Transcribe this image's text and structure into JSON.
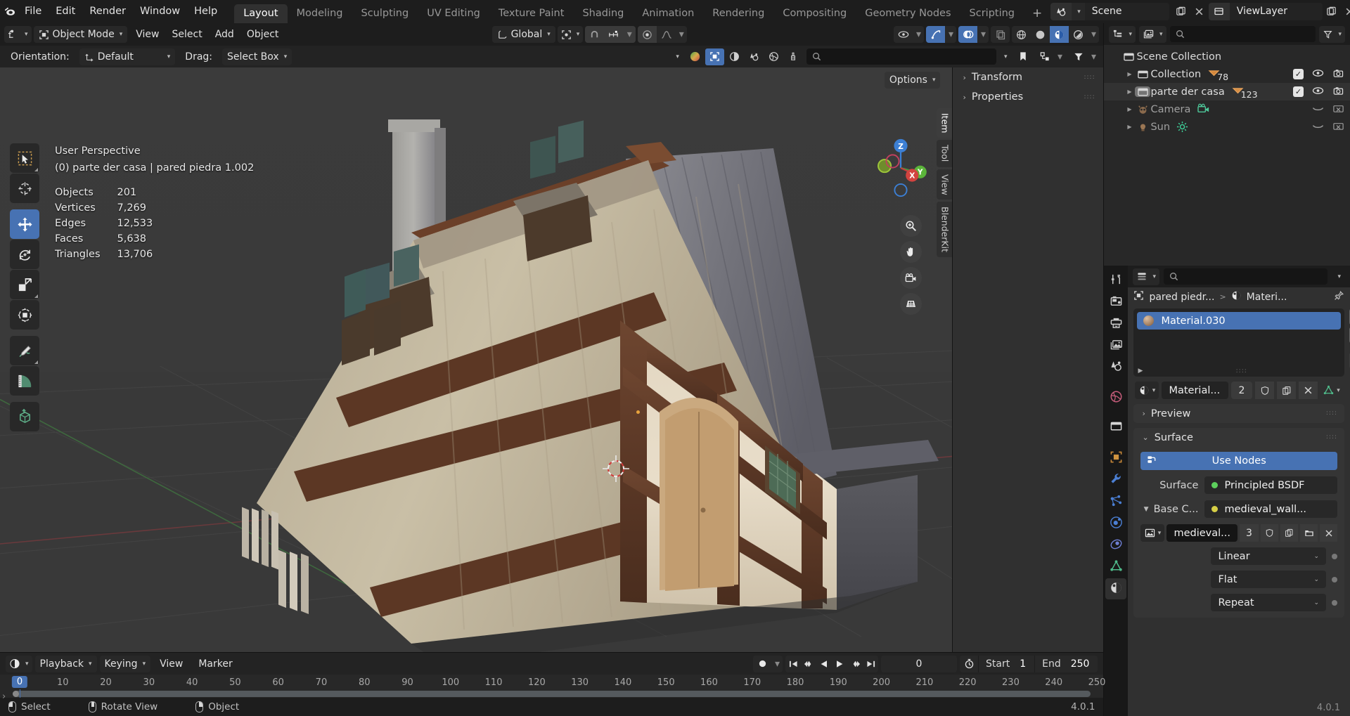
{
  "app": {
    "version": "4.0.1"
  },
  "topbar": {
    "logo_icon": "blender-logo-icon",
    "menus": [
      "File",
      "Edit",
      "Render",
      "Window",
      "Help"
    ],
    "workspace_tabs": [
      {
        "label": "Layout",
        "active": true
      },
      {
        "label": "Modeling",
        "active": false
      },
      {
        "label": "Sculpting",
        "active": false
      },
      {
        "label": "UV Editing",
        "active": false
      },
      {
        "label": "Texture Paint",
        "active": false
      },
      {
        "label": "Shading",
        "active": false
      },
      {
        "label": "Animation",
        "active": false
      },
      {
        "label": "Rendering",
        "active": false
      },
      {
        "label": "Compositing",
        "active": false
      },
      {
        "label": "Geometry Nodes",
        "active": false
      },
      {
        "label": "Scripting",
        "active": false
      }
    ],
    "add_workspace_label": "+",
    "scene": {
      "icon": "scene-icon",
      "name": "Scene",
      "new_icon": "new-scene-icon",
      "unlink_icon": "unlink-icon"
    },
    "viewlayer": {
      "icon": "viewlayer-icon",
      "name": "ViewLayer",
      "new_icon": "new-viewlayer-icon",
      "remove_icon": "remove-viewlayer-icon"
    }
  },
  "viewport_header": {
    "editor_type_icon": "editor-type-icon",
    "mode": "Object Mode",
    "menus": [
      "View",
      "Select",
      "Add",
      "Object"
    ],
    "transform_orientation": "Global",
    "pivot_icon": "pivot-point-icon",
    "snap_magnet_icon": "snap-magnet-icon",
    "snap_increment_icon": "snap-increment-icon",
    "proportional_icon": "proportional-editing-icon",
    "falloff_icon": "proportional-falloff-icon",
    "gizmo_icon": "gizmo-icon",
    "overlay_icon": "overlays-icon",
    "xray_icon": "xray-icon",
    "shading_wireframe_icon": "shading-wireframe-icon",
    "shading_solid_icon": "shading-solid-icon",
    "shading_material_icon": "shading-material-preview-icon",
    "shading_rendered_icon": "shading-rendered-icon",
    "visibility_icon": "visibility-icon"
  },
  "tool_header": {
    "orientation_label": "Orientation:",
    "orientation_value": "Default",
    "drag_label": "Drag:",
    "drag_value": "Select Box",
    "options_label": "Options",
    "mode_icons": [
      "render-icon",
      "output-icon",
      "viewlayer-props-icon",
      "scene-props-icon",
      "world-props-icon",
      "tool-props-icon"
    ],
    "search_placeholder": ""
  },
  "toolbar": {
    "tools": [
      {
        "name": "tweak-tool",
        "icon": "cursor-arrow-icon",
        "active": false
      },
      {
        "name": "cursor-tool",
        "icon": "3d-cursor-icon",
        "active": false
      },
      {
        "name": "move-tool",
        "icon": "move-arrows-icon",
        "active": true
      },
      {
        "name": "rotate-tool",
        "icon": "rotate-icon",
        "active": false
      },
      {
        "name": "scale-tool",
        "icon": "scale-icon",
        "active": false
      },
      {
        "name": "transform-tool",
        "icon": "transform-icon",
        "active": false
      },
      {
        "name": "annotate-tool",
        "icon": "pencil-icon",
        "active": false
      },
      {
        "name": "measure-tool",
        "icon": "ruler-icon",
        "active": false
      },
      {
        "name": "add-cube-tool",
        "icon": "add-cube-icon",
        "active": false
      }
    ]
  },
  "viewport": {
    "perspective": "User Perspective",
    "context": "(0) parte der casa | pared piedra 1.002",
    "stats": [
      {
        "label": "Objects",
        "value": "201"
      },
      {
        "label": "Vertices",
        "value": "7,269"
      },
      {
        "label": "Edges",
        "value": "12,533"
      },
      {
        "label": "Faces",
        "value": "5,638"
      },
      {
        "label": "Triangles",
        "value": "13,706"
      }
    ],
    "gizmo_axes": [
      "Z",
      "X",
      "Y"
    ],
    "nav_buttons": [
      "zoom-icon",
      "pan-hand-icon",
      "camera-view-icon",
      "toggle-perspective-icon"
    ]
  },
  "npanel": {
    "sections": [
      {
        "label": "Transform",
        "expanded": false
      },
      {
        "label": "Properties",
        "expanded": false
      }
    ],
    "tabs": [
      {
        "label": "Item",
        "active": true
      },
      {
        "label": "Tool",
        "active": false
      },
      {
        "label": "View",
        "active": false
      },
      {
        "label": "BlenderKit",
        "active": false
      }
    ]
  },
  "outliner": {
    "display_mode_icon": "outliner-display-mode-icon",
    "filter_id_icon": "filter-id-icon",
    "search_placeholder": "",
    "filter_icon": "funnel-filter-icon",
    "rows": [
      {
        "name": "Scene Collection",
        "icon": "collection-icon",
        "indent": 0,
        "disclosure": "none",
        "badge": "",
        "dim": false,
        "selected": false,
        "checkbox": false,
        "eye": false,
        "camera": false
      },
      {
        "name": "Collection",
        "icon": "collection-icon",
        "indent": 1,
        "disclosure": "closed",
        "badge": "78",
        "badge_icon": "mesh-data-icon",
        "dim": false,
        "selected": false,
        "checkbox": true,
        "eye": true,
        "camera": true
      },
      {
        "name": "parte der casa",
        "icon": "collection-icon",
        "indent": 1,
        "disclosure": "closed",
        "badge": "123",
        "badge_icon": "mesh-data-icon",
        "dim": false,
        "selected": true,
        "checkbox": true,
        "eye": true,
        "camera": true
      },
      {
        "name": "Camera",
        "icon": "camera-object-icon",
        "indent": 1,
        "disclosure": "closed",
        "badge": "",
        "badge_icon": "camera-data-icon",
        "dim": true,
        "selected": false,
        "checkbox": false,
        "eye": true,
        "camera": true
      },
      {
        "name": "Sun",
        "icon": "light-object-icon",
        "indent": 1,
        "disclosure": "closed",
        "badge": "",
        "badge_icon": "sun-data-icon",
        "dim": true,
        "selected": false,
        "checkbox": false,
        "eye": true,
        "camera": true
      }
    ]
  },
  "properties": {
    "editor_icon": "properties-editor-icon",
    "search_placeholder": "",
    "breadcrumb": {
      "object": "pared piedr...",
      "separator": ">",
      "material": "Materi...",
      "object_icon": "object-data-icon",
      "material_icon": "material-icon",
      "pin_icon": "pin-icon"
    },
    "tabs": [
      {
        "name": "tool-tab",
        "icon": "tool-icon",
        "active": false
      },
      {
        "name": "render-tab",
        "icon": "render-camera-icon",
        "active": false
      },
      {
        "name": "output-tab",
        "icon": "printer-icon",
        "active": false
      },
      {
        "name": "viewlayer-tab",
        "icon": "images-icon",
        "active": false
      },
      {
        "name": "scene-tab",
        "icon": "scene-cone-icon",
        "active": false
      },
      {
        "name": "world-tab",
        "icon": "world-globe-icon",
        "active": false
      },
      {
        "name": "collection-tab",
        "icon": "collection-box-icon",
        "active": false
      },
      {
        "name": "object-tab",
        "icon": "object-square-icon",
        "active": false
      },
      {
        "name": "modifiers-tab",
        "icon": "wrench-icon",
        "active": false
      },
      {
        "name": "particles-tab",
        "icon": "particles-icon",
        "active": false
      },
      {
        "name": "physics-tab",
        "icon": "physics-orbit-icon",
        "active": false
      },
      {
        "name": "constraints-tab",
        "icon": "constraint-icon",
        "active": false
      },
      {
        "name": "data-tab",
        "icon": "mesh-data-triangle-icon",
        "active": false
      },
      {
        "name": "material-tab",
        "icon": "material-sphere-icon",
        "active": true
      }
    ],
    "material_slot": {
      "name": "Material.030",
      "selected": true
    },
    "slot_buttons": {
      "add": "+",
      "remove": "−",
      "menu_icon": "chevron-down-icon"
    },
    "material_row": {
      "browse_icon": "browse-material-icon",
      "name": "Material...",
      "users": "2",
      "fake_user_icon": "shield-icon",
      "new_icon": "copy-new-icon",
      "unlink_icon": "x-unlink-icon",
      "data_icon": "mesh-data-triangle-icon"
    },
    "panels": [
      {
        "label": "Preview",
        "expanded": false
      },
      {
        "label": "Surface",
        "expanded": true
      }
    ],
    "use_nodes_label": "Use Nodes",
    "use_nodes_icon": "nodes-icon",
    "surface_label": "Surface",
    "surface_value": "Principled BSDF",
    "base_color_label": "Base C...",
    "base_color_value": "medieval_wall...",
    "texture_row": {
      "browse_icon": "browse-image-icon",
      "name": "medieval...",
      "users": "3",
      "fake_user_icon": "shield-icon",
      "new_icon": "copy-new-icon",
      "open_icon": "folder-open-icon",
      "unlink_icon": "x-unlink-icon"
    },
    "interpolation": "Linear",
    "projection": "Flat",
    "extension": "Repeat"
  },
  "timeline": {
    "editor_icon": "timeline-editor-icon",
    "menus": [
      "Playback",
      "Keying",
      "View",
      "Marker"
    ],
    "record_icon": "auto-keying-record-icon",
    "transport_icons": [
      "jump-to-start-icon",
      "jump-prev-keyframe-icon",
      "play-reverse-icon",
      "play-icon",
      "jump-next-keyframe-icon",
      "jump-to-end-icon"
    ],
    "current_frame": "0",
    "timer_icon": "use-preview-range-icon",
    "start_label": "Start",
    "start_value": "1",
    "end_label": "End",
    "end_value": "250",
    "playhead_frame": "0",
    "ticks": [
      0,
      10,
      20,
      30,
      40,
      50,
      60,
      70,
      80,
      90,
      100,
      110,
      120,
      130,
      140,
      150,
      160,
      170,
      180,
      190,
      200,
      210,
      220,
      230,
      240,
      250
    ]
  },
  "statusbar": {
    "items": [
      {
        "mouse": "left",
        "label": "Select"
      },
      {
        "mouse": "middle",
        "label": "Rotate View"
      },
      {
        "mouse": "right",
        "label": "Object"
      }
    ],
    "version": "4.0.1"
  },
  "colors": {
    "accent": "#4772b3",
    "panel": "#303030",
    "header": "#1d1d1d",
    "editor": "#282828",
    "viewport_sky": "#3b3b3b",
    "viewport_ground": "#393939"
  }
}
